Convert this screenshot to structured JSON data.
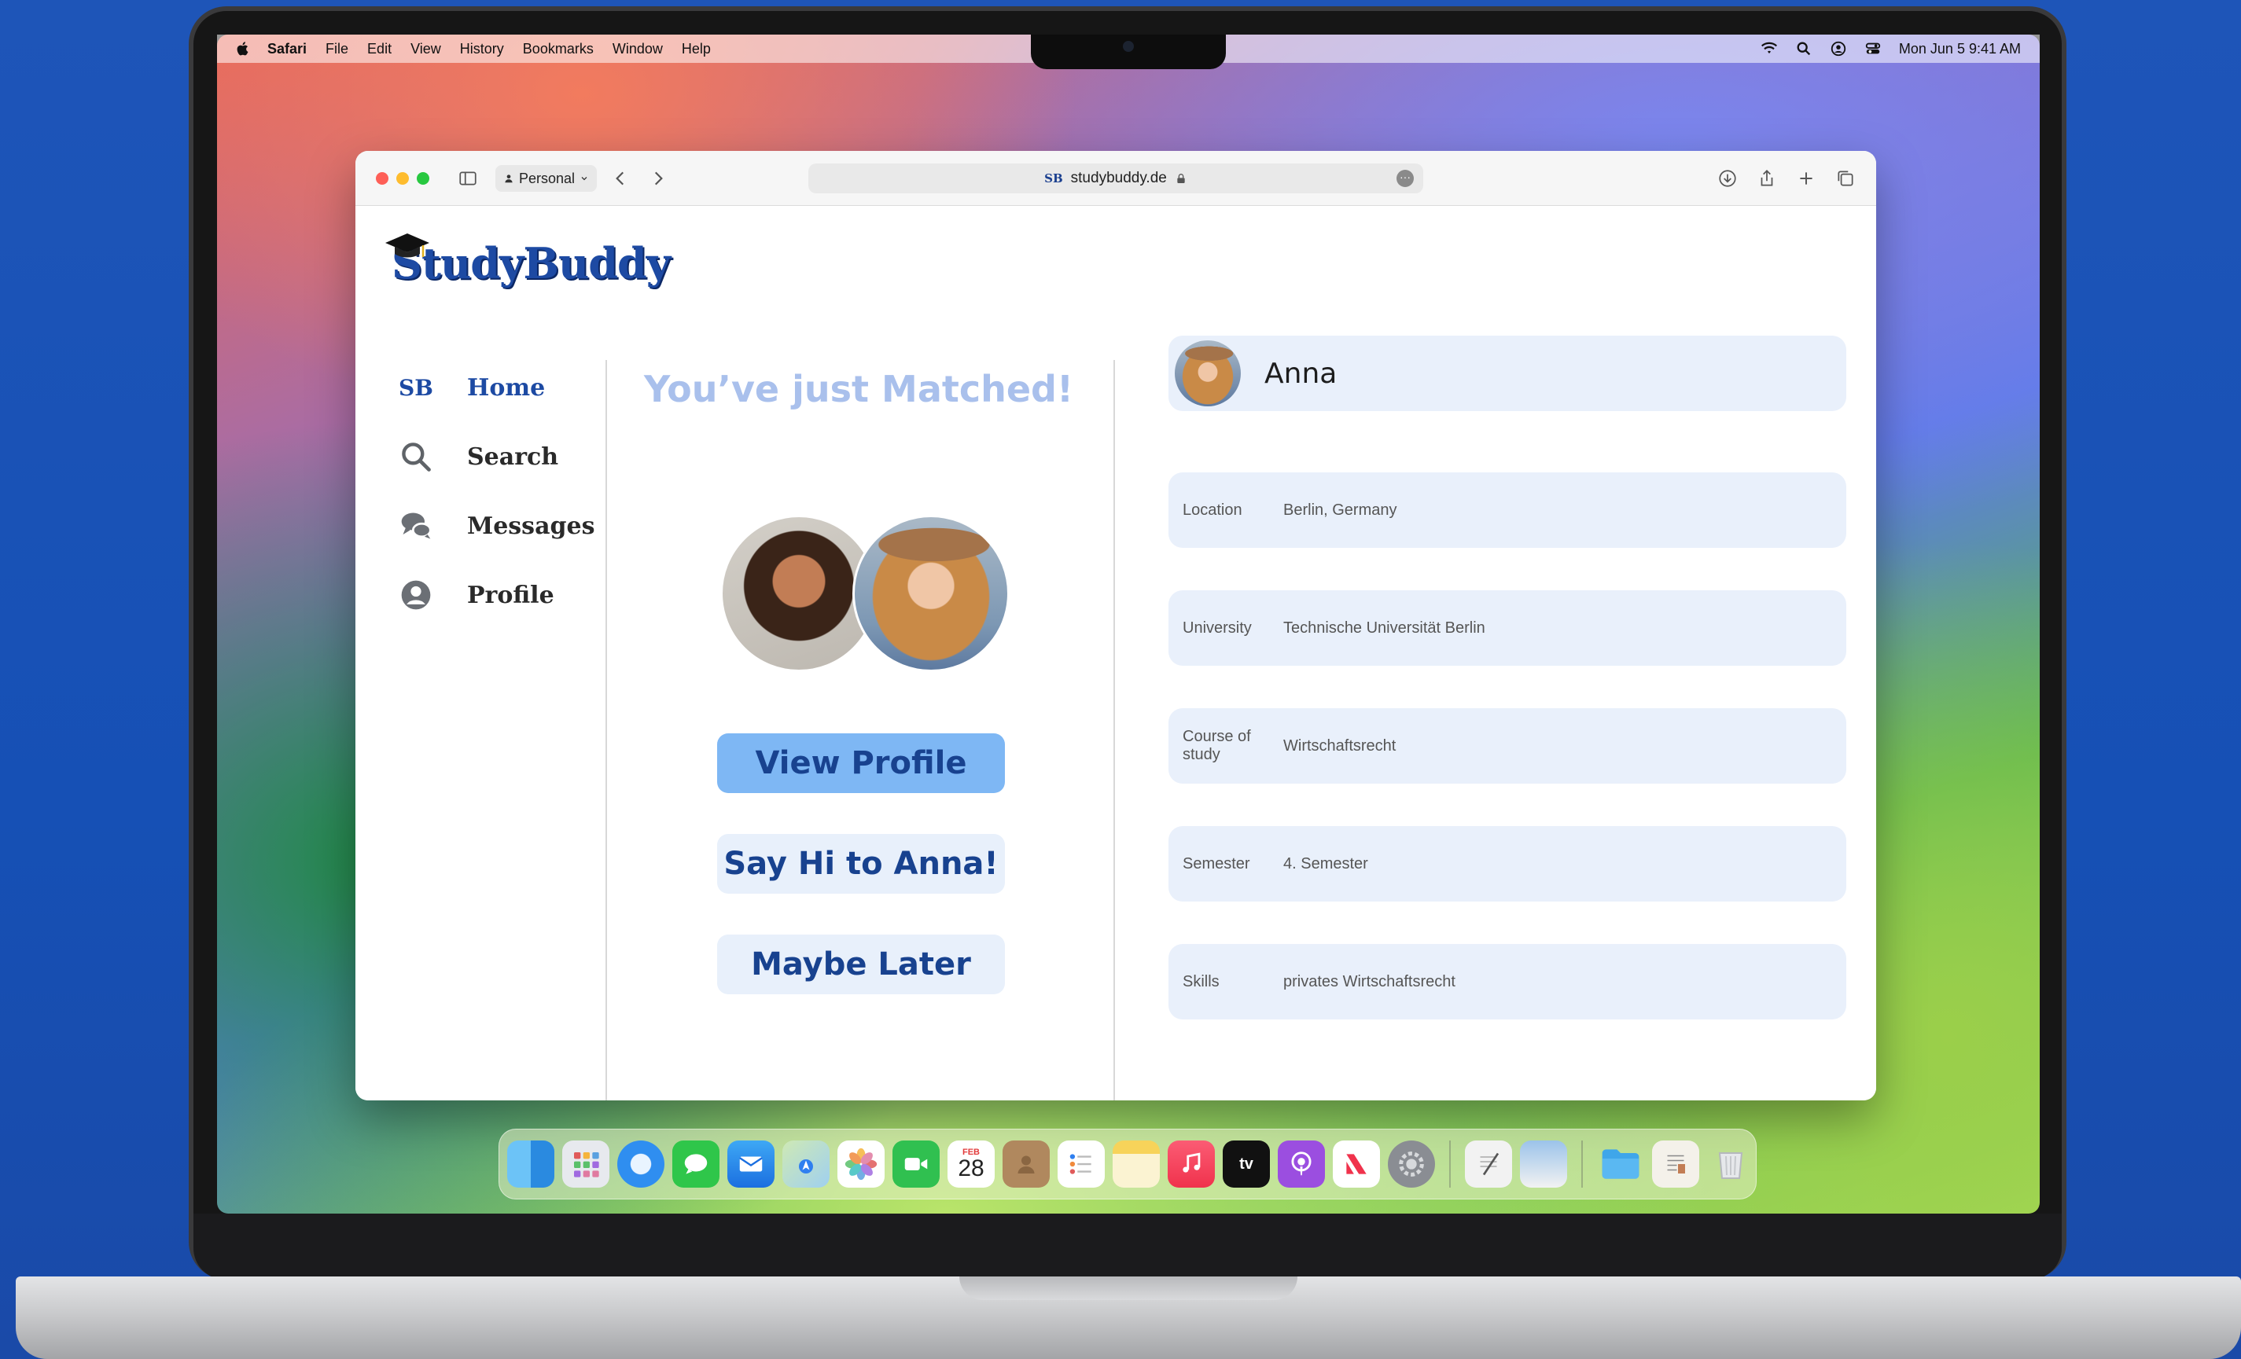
{
  "menubar": {
    "app_name": "Safari",
    "items": [
      "File",
      "Edit",
      "View",
      "History",
      "Bookmarks",
      "Window",
      "Help"
    ],
    "clock": "Mon Jun 5  9:41 AM"
  },
  "browser": {
    "profile_label": "Personal",
    "url": "studybuddy.de",
    "favicon_text": "SB"
  },
  "site": {
    "logo": "StudyBuddy",
    "nav": [
      {
        "label": "Home",
        "icon": "sb-logo-icon",
        "active": true
      },
      {
        "label": "Search",
        "icon": "search-icon"
      },
      {
        "label": "Messages",
        "icon": "chat-bubbles-icon"
      },
      {
        "label": "Profile",
        "icon": "user-circle-icon"
      }
    ],
    "nav_mark": "SB"
  },
  "match": {
    "title": "You’ve just Matched!",
    "buttons": {
      "view_profile": "View Profile",
      "say_hi": "Say Hi to Anna!",
      "maybe_later": "Maybe Later"
    }
  },
  "profile": {
    "name": "Anna",
    "fields": [
      {
        "key": "Location",
        "value": "Berlin, Germany"
      },
      {
        "key": "University",
        "value": "Technische Universität Berlin"
      },
      {
        "key": "Course of study",
        "value": "Wirtschaftsrecht"
      },
      {
        "key": "Semester",
        "value": "4. Semester"
      },
      {
        "key": "Skills",
        "value": "privates Wirtschaftsrecht"
      }
    ]
  },
  "dock": {
    "calendar_month": "FEB",
    "calendar_day": "28",
    "tv_label": "tv"
  },
  "colors": {
    "brand": "#1d4aa3",
    "accent_button": "#7eb7f4",
    "card_bg": "#e9f0fb",
    "match_title": "#a9c0ec"
  }
}
